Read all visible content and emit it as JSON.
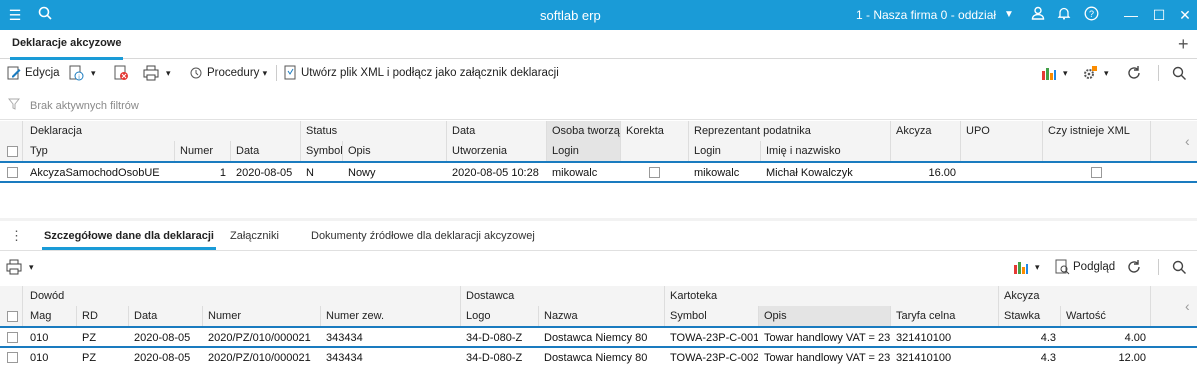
{
  "titlebar": {
    "app_title": "softlab erp",
    "company": "1 - Nasza firma 0 - oddział"
  },
  "tabs": [
    {
      "label": "Deklaracje akcyzowe"
    }
  ],
  "toolbar": {
    "edit_label": "Edycja",
    "procedures_label": "Procedury",
    "xml_label": "Utwórz plik XML i podłącz jako załącznik deklaracji"
  },
  "filter": {
    "text": "Brak aktywnych filtrów"
  },
  "main_grid": {
    "group_headers": [
      "Deklaracja",
      "Status",
      "Data",
      "Osoba tworzą",
      "Korekta",
      "Reprezentant podatnika",
      "Akcyza",
      "UPO",
      "Czy istnieje XML"
    ],
    "sub_headers": [
      "Typ",
      "Numer",
      "Data",
      "Symbol",
      "Opis",
      "Utworzenia",
      "Login",
      "Login",
      "Imię i nazwisko"
    ],
    "rows": [
      {
        "typ": "AkcyzaSamochodOsobUE",
        "numer": "1",
        "data": "2020-08-05",
        "symbol": "N",
        "opis": "Nowy",
        "utworzenia": "2020-08-05 10:28",
        "login": "mikowalc",
        "rep_login": "mikowalc",
        "rep_name": "Michał Kowalczyk",
        "akcyza": "16.00"
      }
    ]
  },
  "detail_tabs": [
    "Szczegółowe dane dla deklaracji",
    "Załączniki",
    "Dokumenty źródłowe dla deklaracji akcyzowej"
  ],
  "detail_toolbar": {
    "preview_label": "Podgląd"
  },
  "detail_grid": {
    "group_headers": [
      "Dowód",
      "Dostawca",
      "Kartoteka",
      "Akcyza"
    ],
    "sub_headers": [
      "Mag",
      "RD",
      "Data",
      "Numer",
      "Numer zew.",
      "Logo",
      "Nazwa",
      "Symbol",
      "Opis",
      "Taryfa celna",
      "Stawka",
      "Wartość"
    ],
    "rows": [
      {
        "mag": "010",
        "rd": "PZ",
        "data": "2020-08-05",
        "numer": "2020/PZ/010/000021",
        "numer_zew": "343434",
        "logo": "34-D-080-Z",
        "nazwa": "Dostawca Niemcy 80",
        "symbol": "TOWA-23P-C-001",
        "opis": "Towar handlowy VAT = 23",
        "taryfa": "321410100",
        "stawka": "4.3",
        "wartosc": "4.00"
      },
      {
        "mag": "010",
        "rd": "PZ",
        "data": "2020-08-05",
        "numer": "2020/PZ/010/000021",
        "numer_zew": "343434",
        "logo": "34-D-080-Z",
        "nazwa": "Dostawca Niemcy 80",
        "symbol": "TOWA-23P-C-002",
        "opis": "Towar handlowy VAT = 23",
        "taryfa": "321410100",
        "stawka": "4.3",
        "wartosc": "12.00"
      }
    ]
  },
  "colors": {
    "accent": "#1a9bd7",
    "header_bg": "#f4f4f4",
    "selected_border": "#1a7bbf"
  }
}
